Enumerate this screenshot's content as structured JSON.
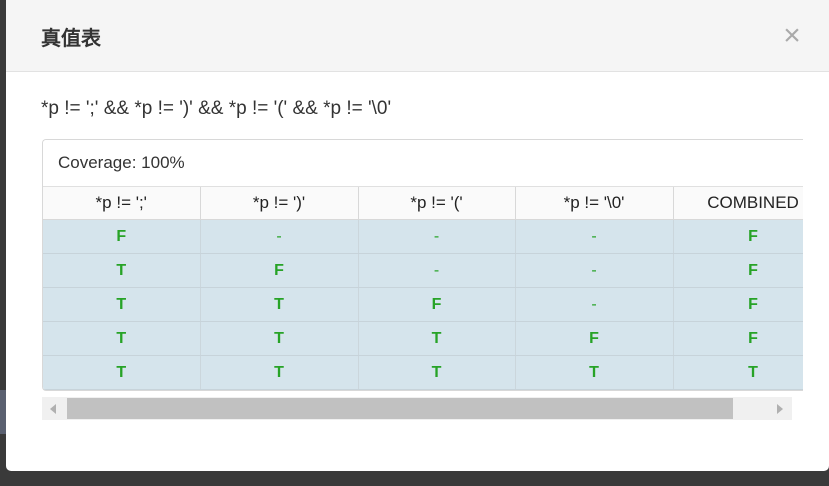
{
  "dialog": {
    "title": "真值表",
    "close_glyph": "×"
  },
  "expression": "*p != ';' && *p != ')' && *p != '(' && *p != '\\0'",
  "coverage_label": "Coverage: 100%",
  "table": {
    "headers": [
      "*p != ';'",
      "*p != ')'",
      "*p != '('",
      "*p != '\\0'",
      "COMBINED"
    ],
    "rows": [
      [
        "F",
        "-",
        "-",
        "-",
        "F"
      ],
      [
        "T",
        "F",
        "-",
        "-",
        "F"
      ],
      [
        "T",
        "T",
        "F",
        "-",
        "F"
      ],
      [
        "T",
        "T",
        "T",
        "F",
        "F"
      ],
      [
        "T",
        "T",
        "T",
        "T",
        "T"
      ]
    ]
  },
  "colors": {
    "true_false_text": "#27a327",
    "row_background": "#d5e4ec"
  }
}
